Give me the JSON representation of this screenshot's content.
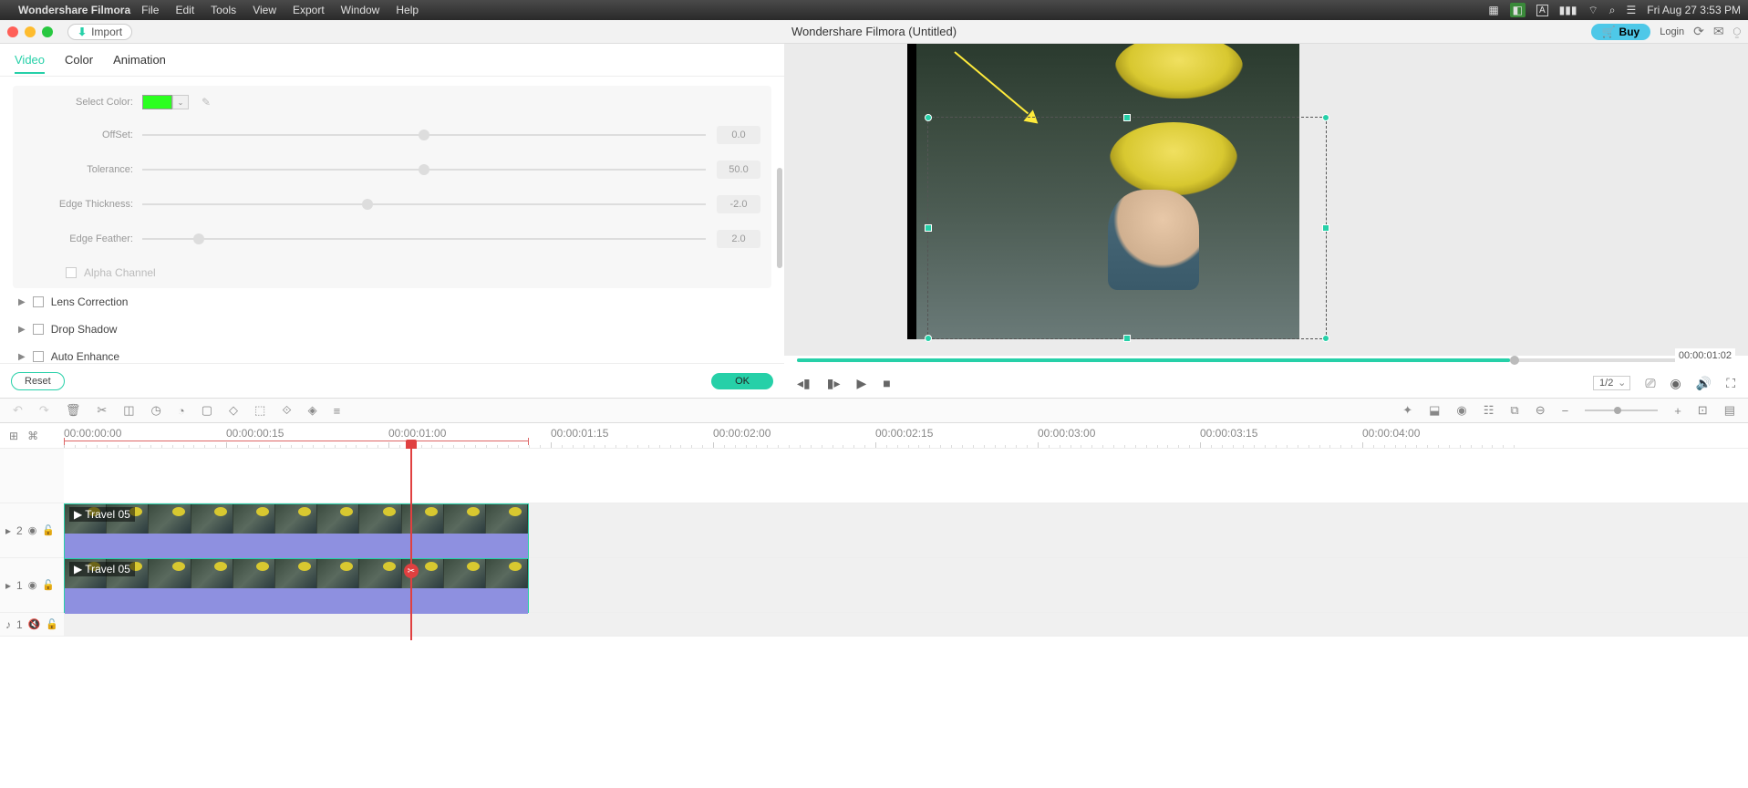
{
  "menubar": {
    "app": "Wondershare Filmora",
    "items": [
      "File",
      "Edit",
      "Tools",
      "View",
      "Export",
      "Window",
      "Help"
    ],
    "clock": "Fri Aug 27  3:53 PM"
  },
  "toolbar": {
    "import": "Import",
    "title": "Wondershare Filmora (Untitled)",
    "buy": "Buy",
    "login": "Login"
  },
  "tabs": {
    "video": "Video",
    "color": "Color",
    "animation": "Animation"
  },
  "controls": {
    "select_color": "Select Color:",
    "offset": {
      "label": "OffSet:",
      "value": "0.0",
      "pos": 50
    },
    "tolerance": {
      "label": "Tolerance:",
      "value": "50.0",
      "pos": 50
    },
    "edge_thickness": {
      "label": "Edge Thickness:",
      "value": "-2.0",
      "pos": 40
    },
    "edge_feather": {
      "label": "Edge Feather:",
      "value": "2.0",
      "pos": 10
    },
    "alpha": "Alpha Channel"
  },
  "collapsibles": {
    "lens": "Lens Correction",
    "drop": "Drop Shadow",
    "auto": "Auto Enhance"
  },
  "footer": {
    "reset": "Reset",
    "ok": "OK"
  },
  "preview": {
    "timecode": "00:00:01:02",
    "ratio": "1/2"
  },
  "ruler": {
    "labels": [
      "00:00:00:00",
      "00:00:00:15",
      "00:00:01:00",
      "00:00:01:15",
      "00:00:02:00",
      "00:00:02:15",
      "00:00:03:00",
      "00:00:03:15",
      "00:00:04:00"
    ],
    "playhead_label": "00:00:01:00"
  },
  "tracks": {
    "t2": "2",
    "t1": "1",
    "clipname": "Travel 05"
  }
}
